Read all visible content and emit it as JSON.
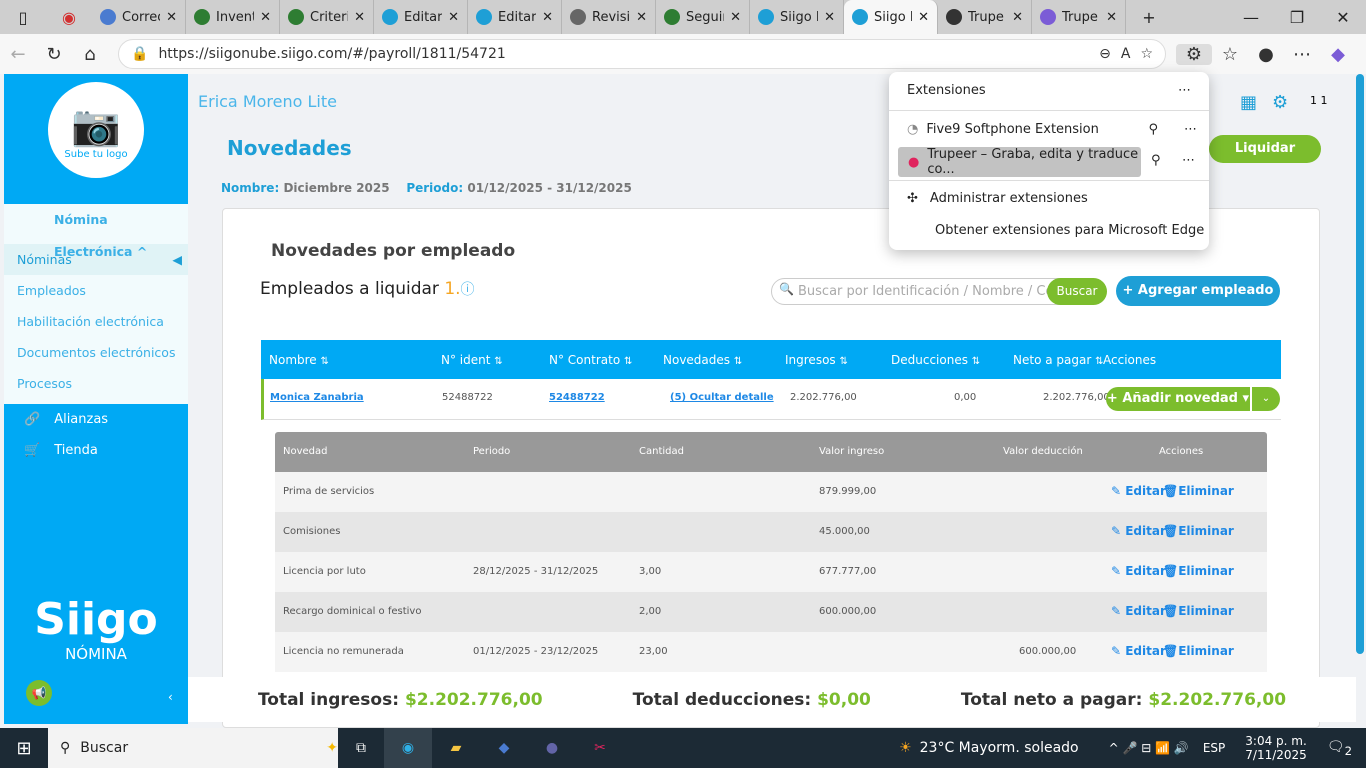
{
  "browser": {
    "tabs": [
      {
        "label": "Correo",
        "color": "#4a7bd0"
      },
      {
        "label": "Inventa",
        "color": "#2e7d32"
      },
      {
        "label": "Criteri",
        "color": "#2e7d32"
      },
      {
        "label": "Editar",
        "color": "#1e9fd6"
      },
      {
        "label": "Editar",
        "color": "#1e9fd6"
      },
      {
        "label": "Revisió",
        "color": "#666"
      },
      {
        "label": "Seguim",
        "color": "#2e7d32"
      },
      {
        "label": "Siigo N",
        "color": "#1e9fd6"
      },
      {
        "label": "Siigo N",
        "color": "#1e9fd6",
        "active": true
      },
      {
        "label": "Trupe",
        "color": "#333"
      },
      {
        "label": "Trupe",
        "color": "#7b5cd6"
      }
    ],
    "url": "https://siigonube.siigo.com/#/payroll/1811/54721"
  },
  "extensions_menu": {
    "title": "Extensiones",
    "items": [
      "Five9 Softphone Extension",
      "Trupeer – Graba, edita y traduce co..."
    ],
    "manage": "Administrar extensiones",
    "get": "Obtener extensiones para Microsoft Edge"
  },
  "sidebar": {
    "logo_text": "Sube tu logo",
    "section": "Nómina Electrónica ^",
    "items": [
      "Nóminas",
      "Empleados",
      "Habilitación electrónica",
      "Documentos electrónicos",
      "Procesos"
    ],
    "extra": [
      "Alianzas",
      "Tienda"
    ],
    "brand": "Siigo",
    "brand_sub": "NÓMINA"
  },
  "header": {
    "company": "Erica Moreno Lite",
    "user_badge": "1 1",
    "liquidar": "Liquidar"
  },
  "page": {
    "title": "Novedades",
    "nombre_label": "Nombre:",
    "nombre": "Diciembre 2025",
    "periodo_label": "Periodo:",
    "periodo": "01/12/2025 - 31/12/2025",
    "card_title": "Novedades por empleado",
    "empleados_label": "Empleados a liquidar",
    "empleados_count": "1.",
    "search_placeholder": "Buscar por Identificación / Nombre / Contrato",
    "buscar": "Buscar",
    "agregar": "Agregar empleado"
  },
  "table": {
    "headers": [
      "Nombre",
      "N° ident",
      "N° Contrato",
      "Novedades",
      "Ingresos",
      "Deducciones",
      "Neto a pagar",
      "Acciones"
    ],
    "row": {
      "nombre": "Monica Zanabria",
      "ident": "52488722",
      "contrato": "52488722",
      "novedades": "(5) Ocultar detalle",
      "ingresos": "2.202.776,00",
      "deducciones": "0,00",
      "neto": "2.202.776,00",
      "action": "Añadir novedad"
    }
  },
  "detail": {
    "headers": [
      "Novedad",
      "Periodo",
      "Cantidad",
      "Valor ingreso",
      "Valor deducción",
      "Acciones"
    ],
    "edit": "Editar",
    "delete": "Eliminar",
    "rows": [
      {
        "novedad": "Prima de servicios",
        "periodo": "",
        "cantidad": "",
        "ingreso": "879.999,00",
        "deduccion": ""
      },
      {
        "novedad": "Comisiones",
        "periodo": "",
        "cantidad": "",
        "ingreso": "45.000,00",
        "deduccion": ""
      },
      {
        "novedad": "Licencia por luto",
        "periodo": "28/12/2025 - 31/12/2025",
        "cantidad": "3,00",
        "ingreso": "677.777,00",
        "deduccion": ""
      },
      {
        "novedad": "Recargo dominical o festivo",
        "periodo": "",
        "cantidad": "2,00",
        "ingreso": "600.000,00",
        "deduccion": ""
      },
      {
        "novedad": "Licencia no remunerada",
        "periodo": "01/12/2025 - 23/12/2025",
        "cantidad": "23,00",
        "ingreso": "",
        "deduccion": "600.000,00"
      }
    ]
  },
  "footer": {
    "ingresos_label": "Total ingresos:",
    "ingresos": "$2.202.776,00",
    "deducciones_label": "Total deducciones:",
    "deducciones": "$0,00",
    "neto_label": "Total neto a pagar:",
    "neto": "$2.202.776,00"
  },
  "taskbar": {
    "search": "Buscar",
    "weather": "23°C  Mayorm. soleado",
    "lang": "ESP",
    "time": "3:04 p. m.",
    "date": "7/11/2025",
    "notifications": "2"
  }
}
